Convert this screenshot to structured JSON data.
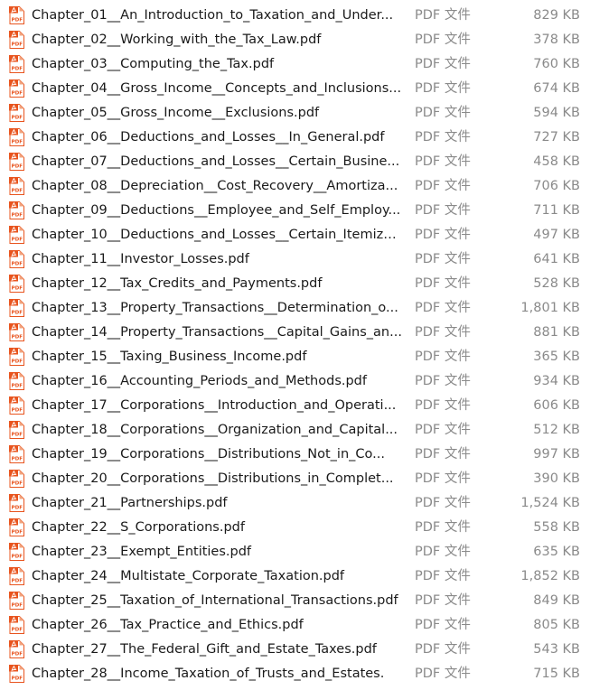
{
  "files": [
    {
      "name": "Chapter_01__An_Introduction_to_Taxation_and_Under...",
      "type": "PDF 文件",
      "size": "829 KB",
      "icon": "pdf-file-icon"
    },
    {
      "name": "Chapter_02__Working_with_the_Tax_Law.pdf",
      "type": "PDF 文件",
      "size": "378 KB",
      "icon": "pdf-file-icon"
    },
    {
      "name": "Chapter_03__Computing_the_Tax.pdf",
      "type": "PDF 文件",
      "size": "760 KB",
      "icon": "pdf-file-icon"
    },
    {
      "name": "Chapter_04__Gross_Income__Concepts_and_Inclusions...",
      "type": "PDF 文件",
      "size": "674 KB",
      "icon": "pdf-file-icon"
    },
    {
      "name": "Chapter_05__Gross_Income__Exclusions.pdf",
      "type": "PDF 文件",
      "size": "594 KB",
      "icon": "pdf-file-icon"
    },
    {
      "name": "Chapter_06__Deductions_and_Losses__In_General.pdf",
      "type": "PDF 文件",
      "size": "727 KB",
      "icon": "pdf-file-icon"
    },
    {
      "name": "Chapter_07__Deductions_and_Losses__Certain_Busine...",
      "type": "PDF 文件",
      "size": "458 KB",
      "icon": "pdf-file-icon"
    },
    {
      "name": "Chapter_08__Depreciation__Cost_Recovery__Amortiza...",
      "type": "PDF 文件",
      "size": "706 KB",
      "icon": "pdf-file-icon"
    },
    {
      "name": "Chapter_09__Deductions__Employee_and_Self_Employ...",
      "type": "PDF 文件",
      "size": "711 KB",
      "icon": "pdf-file-icon"
    },
    {
      "name": "Chapter_10__Deductions_and_Losses__Certain_Itemize...",
      "type": "PDF 文件",
      "size": "497 KB",
      "icon": "pdf-file-icon"
    },
    {
      "name": "Chapter_11__Investor_Losses.pdf",
      "type": "PDF 文件",
      "size": "641 KB",
      "icon": "pdf-file-icon"
    },
    {
      "name": "Chapter_12__Tax_Credits_and_Payments.pdf",
      "type": "PDF 文件",
      "size": "528 KB",
      "icon": "pdf-file-icon"
    },
    {
      "name": "Chapter_13__Property_Transactions__Determination_o...",
      "type": "PDF 文件",
      "size": "1,801 KB",
      "icon": "pdf-file-icon"
    },
    {
      "name": "Chapter_14__Property_Transactions__Capital_Gains_an...",
      "type": "PDF 文件",
      "size": "881 KB",
      "icon": "pdf-file-icon"
    },
    {
      "name": "Chapter_15__Taxing_Business_Income.pdf",
      "type": "PDF 文件",
      "size": "365 KB",
      "icon": "pdf-file-icon"
    },
    {
      "name": "Chapter_16__Accounting_Periods_and_Methods.pdf",
      "type": "PDF 文件",
      "size": "934 KB",
      "icon": "pdf-file-icon"
    },
    {
      "name": "Chapter_17__Corporations__Introduction_and_Operati...",
      "type": "PDF 文件",
      "size": "606 KB",
      "icon": "pdf-file-icon"
    },
    {
      "name": "Chapter_18__Corporations__Organization_and_Capital...",
      "type": "PDF 文件",
      "size": "512 KB",
      "icon": "pdf-file-icon"
    },
    {
      "name": "Chapter_19__Corporations__Distributions_Not_in_Co...",
      "type": "PDF 文件",
      "size": "997 KB",
      "icon": "pdf-file-icon"
    },
    {
      "name": "Chapter_20__Corporations__Distributions_in_Complet...",
      "type": "PDF 文件",
      "size": "390 KB",
      "icon": "pdf-file-icon"
    },
    {
      "name": "Chapter_21__Partnerships.pdf",
      "type": "PDF 文件",
      "size": "1,524 KB",
      "icon": "pdf-file-icon"
    },
    {
      "name": "Chapter_22__S_Corporations.pdf",
      "type": "PDF 文件",
      "size": "558 KB",
      "icon": "pdf-file-icon"
    },
    {
      "name": "Chapter_23__Exempt_Entities.pdf",
      "type": "PDF 文件",
      "size": "635 KB",
      "icon": "pdf-file-icon"
    },
    {
      "name": "Chapter_24__Multistate_Corporate_Taxation.pdf",
      "type": "PDF 文件",
      "size": "1,852 KB",
      "icon": "pdf-file-icon"
    },
    {
      "name": "Chapter_25__Taxation_of_International_Transactions.pdf",
      "type": "PDF 文件",
      "size": "849 KB",
      "icon": "pdf-file-icon"
    },
    {
      "name": "Chapter_26__Tax_Practice_and_Ethics.pdf",
      "type": "PDF 文件",
      "size": "805 KB",
      "icon": "pdf-file-icon"
    },
    {
      "name": "Chapter_27__The_Federal_Gift_and_Estate_Taxes.pdf",
      "type": "PDF 文件",
      "size": "543 KB",
      "icon": "pdf-file-icon"
    },
    {
      "name": "Chapter_28__Income_Taxation_of_Trusts_and_Estates.",
      "type": "PDF 文件",
      "size": "715 KB",
      "icon": "pdf-file-icon"
    }
  ],
  "icon": {
    "label": "PDF",
    "badge_color": "#e8541e",
    "page_color": "#ffffff",
    "fold_color": "#f2a47f"
  },
  "colors": {
    "name_text": "#1a1a1a",
    "meta_text": "#8a8a8a"
  }
}
